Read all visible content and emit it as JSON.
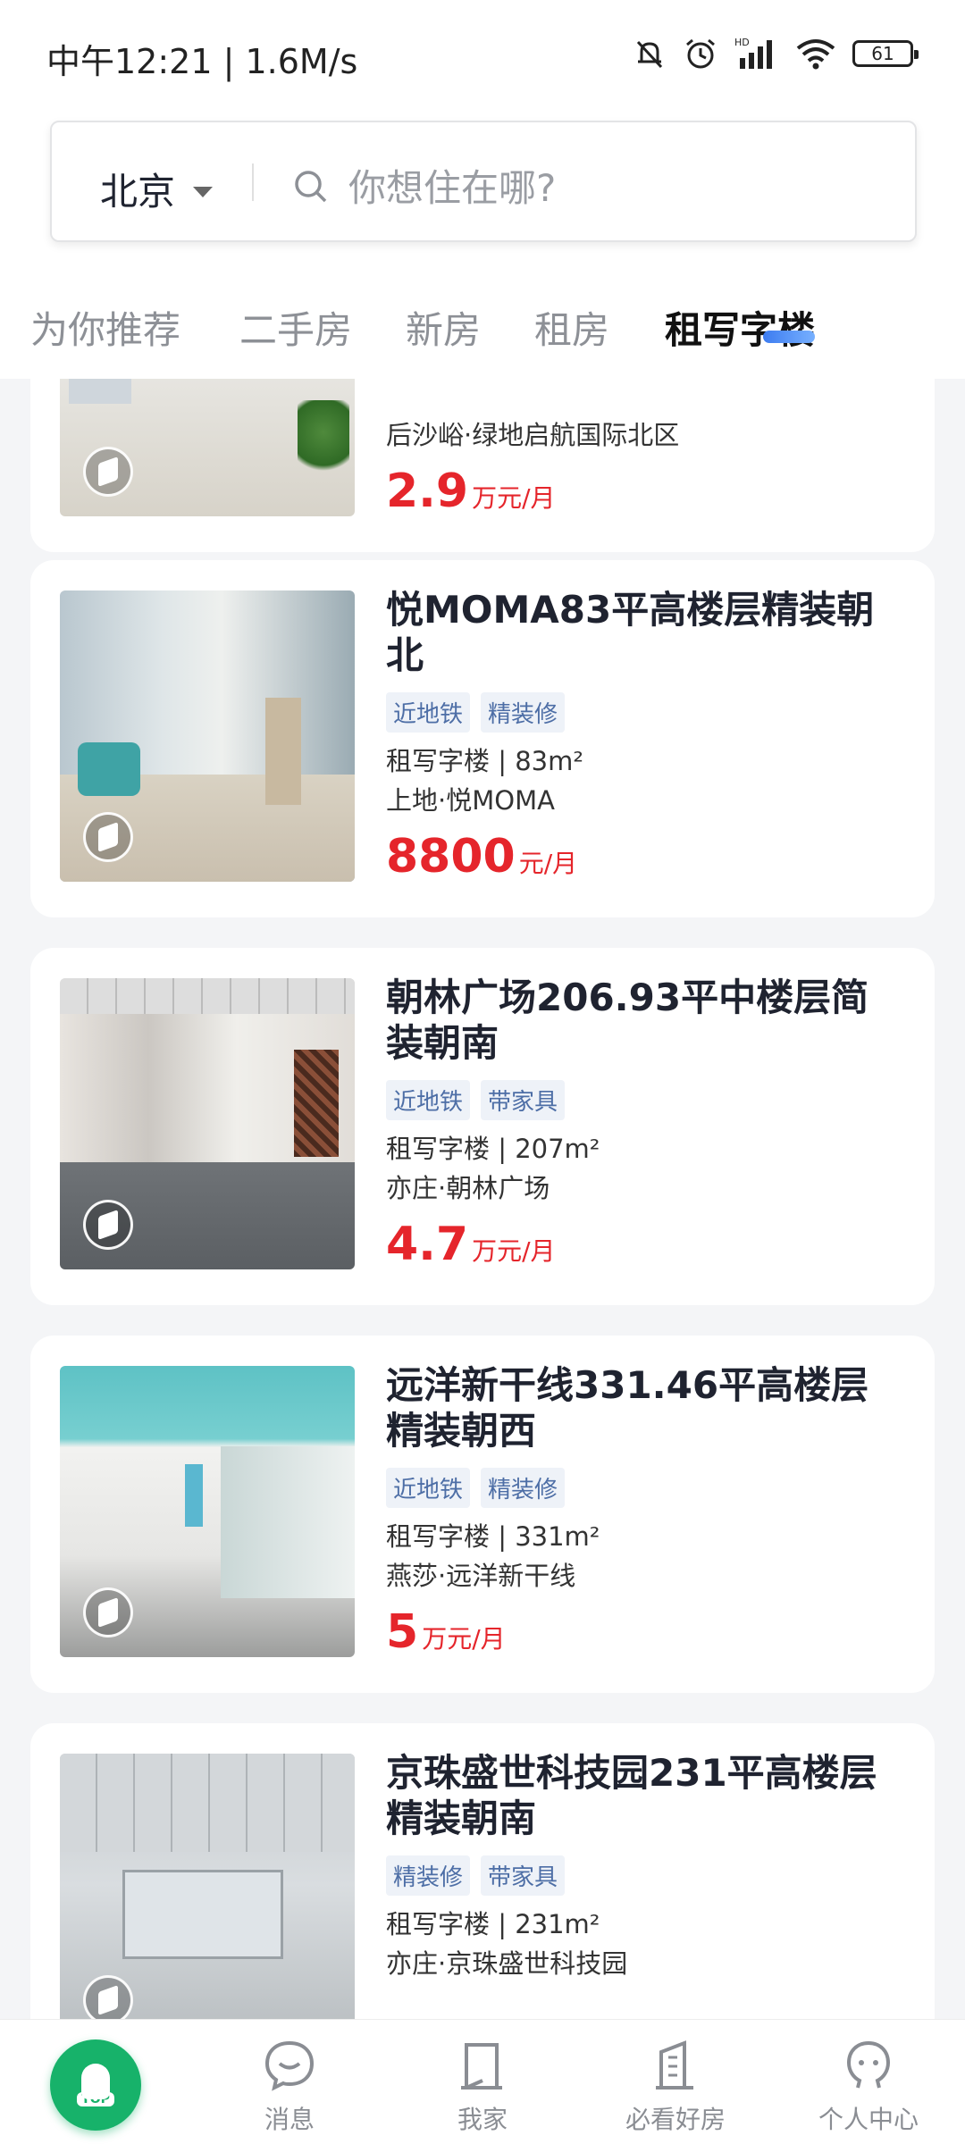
{
  "status": {
    "time": "中午12:21 | 1.6M/s",
    "network_label": "HD",
    "battery": "61"
  },
  "search": {
    "city": "北京",
    "placeholder": "你想住在哪?"
  },
  "tabs": [
    {
      "label": "为你推荐"
    },
    {
      "label": "二手房"
    },
    {
      "label": "新房"
    },
    {
      "label": "租房"
    },
    {
      "label": "租写字楼"
    }
  ],
  "listings": [
    {
      "title": "",
      "tags": [],
      "meta1": "",
      "meta2": "后沙峪·绿地启航国际北区",
      "price": "2.9",
      "unit": "万元/月"
    },
    {
      "title": "悦MOMA83平高楼层精装朝北",
      "tags": [
        "近地铁",
        "精装修"
      ],
      "meta1": "租写字楼 | 83m²",
      "meta2": "上地·悦MOMA",
      "price": "8800",
      "unit": "元/月"
    },
    {
      "title": "朝林广场206.93平中楼层简装朝南",
      "tags": [
        "近地铁",
        "带家具"
      ],
      "meta1": "租写字楼 | 207m²",
      "meta2": "亦庄·朝林广场",
      "price": "4.7",
      "unit": "万元/月"
    },
    {
      "title": "远洋新干线331.46平高楼层精装朝西",
      "tags": [
        "近地铁",
        "精装修"
      ],
      "meta1": "租写字楼 | 331m²",
      "meta2": "燕莎·远洋新干线",
      "price": "5",
      "unit": "万元/月"
    },
    {
      "title": "京珠盛世科技园231平高楼层精装朝南",
      "tags": [
        "精装修",
        "带家具"
      ],
      "meta1": "租写字楼 | 231m²",
      "meta2": "亦庄·京珠盛世科技园",
      "price": "",
      "unit": ""
    }
  ],
  "bottom_nav": {
    "top_label": "TOP",
    "items": [
      {
        "label": "消息",
        "icon": "message-icon"
      },
      {
        "label": "我家",
        "icon": "home-door-icon"
      },
      {
        "label": "必看好房",
        "icon": "building-icon"
      },
      {
        "label": "个人中心",
        "icon": "profile-icon"
      }
    ]
  },
  "colors": {
    "accent": "#17b26a",
    "price": "#e5252b",
    "tag_bg": "#eef2f8",
    "tag_text": "#4d6ea6",
    "tab_indicator": "#3d7cf0"
  }
}
